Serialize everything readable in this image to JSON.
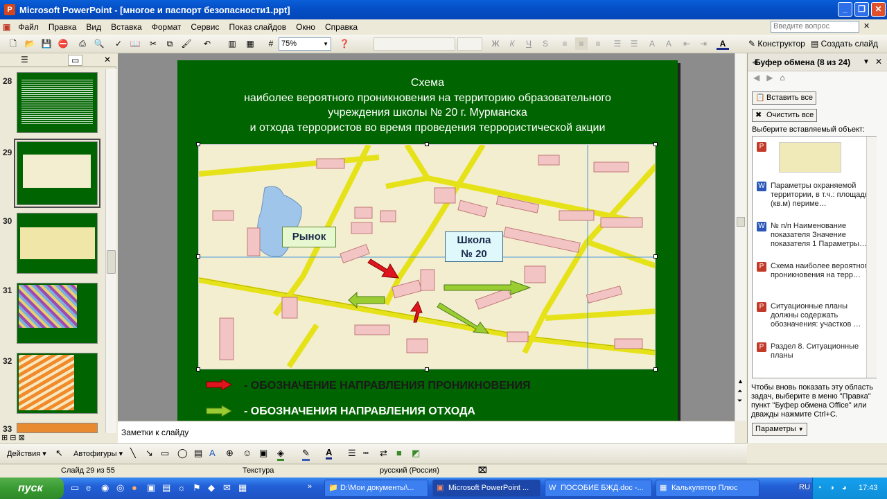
{
  "window": {
    "app_title": "Microsoft PowerPoint - [многое и паспорт безопасности1.ppt]"
  },
  "menu": [
    "Файл",
    "Правка",
    "Вид",
    "Вставка",
    "Формат",
    "Сервис",
    "Показ слайдов",
    "Окно",
    "Справка"
  ],
  "ask_placeholder": "Введите вопрос",
  "toolbar": {
    "zoom": "75%",
    "constructor": "Конструктор",
    "create_slide": "Создать слайд"
  },
  "slides": [
    {
      "num": "28"
    },
    {
      "num": "29"
    },
    {
      "num": "30"
    },
    {
      "num": "31"
    },
    {
      "num": "32"
    },
    {
      "num": "33"
    }
  ],
  "slide": {
    "title_lines": [
      "Схема",
      "наиболее вероятного проникновения на территорию образовательного",
      "учреждения школы № 20 г. Мурманска",
      "и отхода террористов во время проведения террористической акции"
    ],
    "callout_market": "Рынок",
    "callout_school_1": "Школа",
    "callout_school_2": "№ 20",
    "legend_in": "- ОБОЗНАЧЕНИЕ НАПРАВЛЕНИЯ ПРОНИКНОВЕНИЯ",
    "legend_out": "- ОБОЗНАЧЕНИЯ НАПРАВЛЕНИЯ ОТХОДА",
    "colors": {
      "in": "#e0141e",
      "out": "#9acd32",
      "bg": "#006400"
    }
  },
  "notes_placeholder": "Заметки к слайду",
  "taskpane": {
    "title": "Буфер обмена (8 из 24)",
    "paste_all": "Вставить все",
    "clear_all": "Очистить все",
    "select_label": "Выберите вставляемый объект:",
    "items": [
      "Параметры охраняемой территории, в т.ч.: площадь (кв.м) периме…",
      "№ п/п Наименование показателя Значение показателя 1 Параметры…",
      "Схема наиболее вероятного проникновения на терр…",
      "Ситуационные планы должны содержать обозначения: участков …",
      "Раздел 8. Ситуационные планы"
    ],
    "hint": "Чтобы вновь показать эту область задач, выберите в меню \"Правка\" пункт \"Буфер обмена Office\" или дважды нажмите Ctrl+C.",
    "params": "Параметры"
  },
  "drawbar": {
    "actions": "Действия",
    "autoshapes": "Автофигуры"
  },
  "status": {
    "slide": "Слайд 29 из 55",
    "design": "Текстура",
    "lang": "русский (Россия)"
  },
  "taskbar": {
    "start": "пуск",
    "tasks": [
      "D:\\Мои документы\\...",
      "Microsoft PowerPoint ...",
      "ПОСОБИЕ БЖД.doc -...",
      "Калькулятор Плюс"
    ],
    "lang": "RU",
    "time": "17:43"
  }
}
